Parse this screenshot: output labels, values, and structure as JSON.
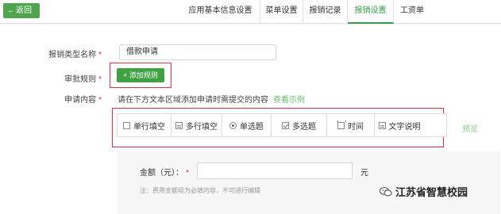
{
  "header": {
    "back_label": "返回",
    "tabs": [
      {
        "label": "应用基本信息设置",
        "active": false
      },
      {
        "label": "菜单设置",
        "active": false
      },
      {
        "label": "报销记录",
        "active": false
      },
      {
        "label": "报销设置",
        "active": true
      },
      {
        "label": "工资单",
        "active": false
      }
    ]
  },
  "form": {
    "type_name_label": "报销类型名称",
    "type_name_value": "借款申请",
    "approval_label": "审批规则",
    "add_rule_label": "+ 添加规则",
    "content_label": "申请内容",
    "content_hint": "请在下方文本区域添加申请时需提交的内容",
    "example_link": "查看示例",
    "required_mark": "*"
  },
  "field_types": [
    {
      "label": "单行填空",
      "icon": "single-line-icon"
    },
    {
      "label": "多行填空",
      "icon": "multi-line-icon"
    },
    {
      "label": "单选题",
      "icon": "radio-icon"
    },
    {
      "label": "多选题",
      "icon": "checkbox-icon"
    },
    {
      "label": "时间",
      "icon": "calendar-icon"
    },
    {
      "label": "文字说明",
      "icon": "text-note-icon"
    }
  ],
  "preview_label": "预览",
  "amount_field": {
    "label": "金额（元）：",
    "required_mark": "*",
    "unit": "元",
    "note": "注：费用金额项为必填内容，不可进行编辑"
  },
  "watermark": {
    "text": "江苏省智慧校园"
  },
  "colors": {
    "accent": "#3fa142",
    "highlight_border": "#d9334f",
    "required": "#e0322c"
  }
}
